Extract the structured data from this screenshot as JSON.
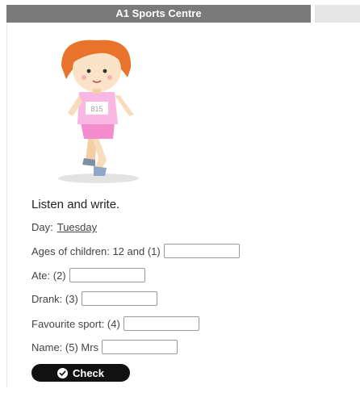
{
  "header": {
    "title": "A1 Sports Centre"
  },
  "illustration": {
    "bib_number": "815",
    "icon": "running-girl-illustration"
  },
  "exercise": {
    "instruction": "Listen and write.",
    "day": {
      "label": "Day:",
      "answer": "Tuesday"
    },
    "ages": {
      "label": "Ages of children: 12 and (1)",
      "value": ""
    },
    "ate": {
      "label": "Ate: (2)",
      "value": ""
    },
    "drank": {
      "label": "Drank: (3)",
      "value": ""
    },
    "sport": {
      "label": "Favourite sport: (4)",
      "value": ""
    },
    "name": {
      "label": "Name: (5) Mrs",
      "value": ""
    }
  },
  "check_button": {
    "label": "Check",
    "icon": "check-circle-icon"
  },
  "colors": {
    "titlebar": "#7a7a7a",
    "button": "#111111",
    "shirt": "#f6a6d8",
    "hair": "#e8732a"
  }
}
